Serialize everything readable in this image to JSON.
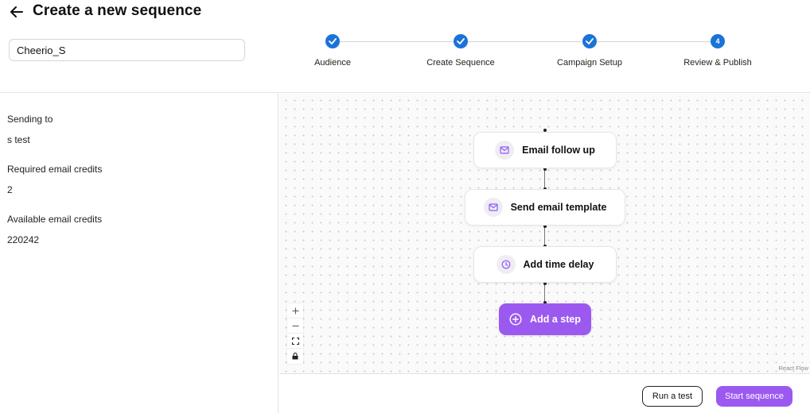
{
  "header": {
    "title": "Create a new sequence",
    "sequence_name": "Cheerio_S"
  },
  "stepper": {
    "steps": [
      {
        "label": "Audience",
        "state": "completed"
      },
      {
        "label": "Create Sequence",
        "state": "completed"
      },
      {
        "label": "Campaign Setup",
        "state": "completed"
      },
      {
        "label": "Review & Publish",
        "state": "current",
        "number": "4"
      }
    ]
  },
  "summary": {
    "sending_to_label": "Sending to",
    "sending_to_value": "s test",
    "required_label": "Required email credits",
    "required_value": "2",
    "available_label": "Available email credits",
    "available_value": "220242"
  },
  "flow": {
    "nodes": [
      {
        "label": "Email follow up",
        "icon": "mail-icon"
      },
      {
        "label": "Send email template",
        "icon": "mail-icon"
      },
      {
        "label": "Add time delay",
        "icon": "clock-icon"
      }
    ],
    "add_step_label": "Add a step",
    "attribution": "React Flow"
  },
  "footer": {
    "run_test_label": "Run a test",
    "start_label": "Start sequence"
  },
  "colors": {
    "step_blue": "#1a73d9",
    "accent_purple": "#9b59f0",
    "icon_purple": "#8b5cf6"
  }
}
